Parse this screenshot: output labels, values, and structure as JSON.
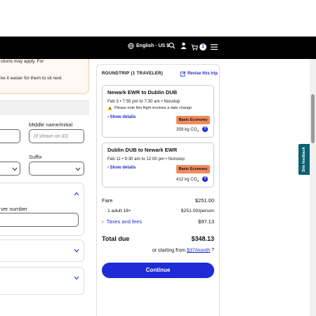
{
  "header": {
    "language_label": "English · US $",
    "cart_count": "1",
    "icons": [
      "globe-icon",
      "search-icon",
      "user-icon",
      "cart-icon",
      "menu-icon"
    ]
  },
  "left_form": {
    "peach_line1": "ctions may apply. For",
    "peach_line2": "ke it easier for them to sit next",
    "middle_name_label": "Middle name/initial",
    "middle_name_placeholder": "(if shown on ID)",
    "suffix_label": "Suffix",
    "number_label": "ver number"
  },
  "summary": {
    "heading": "ROUNDTRIP (1 TRAVELER)",
    "revise_label": "Revise this trip",
    "flights": [
      {
        "route": "Newark EWR to Dublin DUB",
        "times": "Feb 3 • 7:55 pm to 7:30 am • Nonstop",
        "note": "Please note this flight involves a date change",
        "details_label": "Show details",
        "cabin": "Basic Economy",
        "co2": "359 kg CO",
        "co2_sub": "2"
      },
      {
        "route": "Dublin DUB to Newark EWR",
        "times": "Feb 11 • 9:30 am to 12:00 pm • Nonstop",
        "details_label": "Show details",
        "cabin": "Basic Economy",
        "co2": "412 kg CO",
        "co2_sub": "2"
      }
    ],
    "fare_label": "Fare",
    "fare_value": "$251.00",
    "adult_label": "1 adult 18+",
    "adult_value": "$251.00/person",
    "taxes_label": "Taxes and fees",
    "taxes_value": "$97.13",
    "total_label": "Total due",
    "total_value": "$348.13",
    "starting_label": "or starting from",
    "starting_value": "$37/month",
    "continue_label": "Continue"
  },
  "feedback_label": "Site feedback",
  "colors": {
    "accent": "#1e2bd6",
    "cabin_pill": "#f28a5b",
    "feedback_tab": "#0b6272",
    "topbar": "#000000"
  }
}
